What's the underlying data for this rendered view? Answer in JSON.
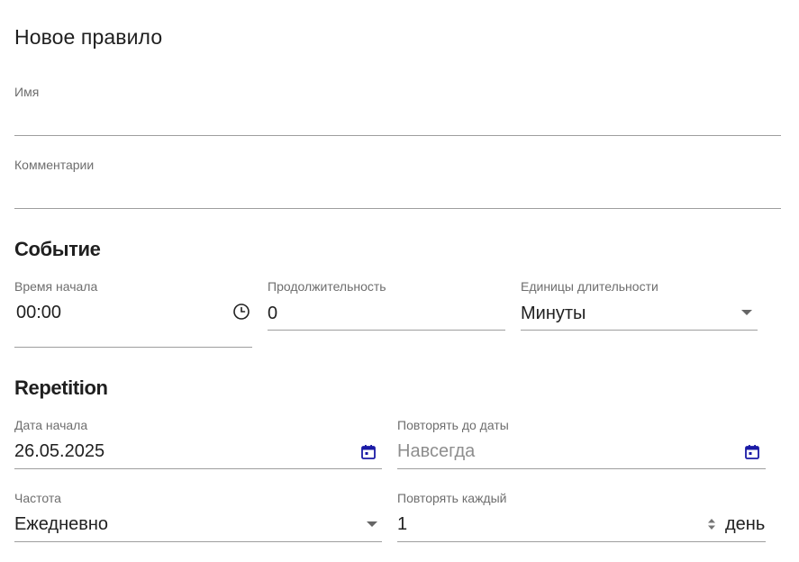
{
  "form": {
    "title": "Новое правило",
    "name_field": {
      "label": "Имя",
      "value": ""
    },
    "comment_field": {
      "label": "Комментарии",
      "value": ""
    }
  },
  "event_section": {
    "title": "Событие",
    "start_time": {
      "label": "Время начала",
      "value": "00:00",
      "icon": "clock-icon"
    },
    "duration": {
      "label": "Продолжительность",
      "value": "0"
    },
    "duration_units": {
      "label": "Единицы длительности",
      "value": "Минуты",
      "icon": "dropdown-arrow-icon"
    }
  },
  "repetition_section": {
    "title": "Repetition",
    "start_date": {
      "label": "Дата начала",
      "value": "26.05.2025",
      "icon": "calendar-icon"
    },
    "repeat_until": {
      "label": "Повторять до даты",
      "placeholder": "Навсегда",
      "icon": "calendar-icon"
    },
    "frequency": {
      "label": "Частота",
      "value": "Ежедневно",
      "icon": "dropdown-arrow-icon"
    },
    "repeat_every": {
      "label": "Повторять каждый",
      "value": "1",
      "suffix": "день",
      "icon": "spinner-icon"
    }
  },
  "colors": {
    "accent_icon": "#1a1aa6",
    "underline": "#9e9e9e",
    "label": "#6e6e6e"
  }
}
